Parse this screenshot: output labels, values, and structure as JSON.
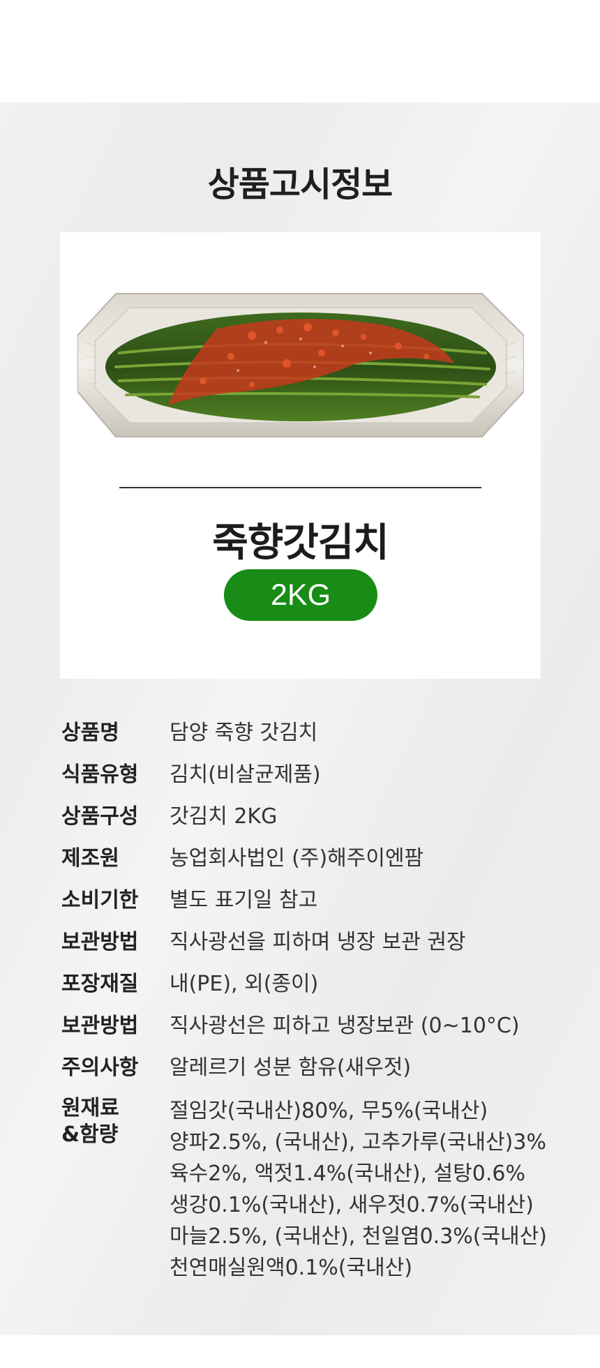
{
  "section_title": "상품고시정보",
  "product": {
    "name": "죽향갓김치",
    "weight": "2KG",
    "badge_color": "#188c16"
  },
  "info_rows": [
    {
      "label": "상품명",
      "value": "담양 죽향 갓김치"
    },
    {
      "label": "식품유형",
      "value": "김치(비살균제품)"
    },
    {
      "label": "상품구성",
      "value": "갓김치 2KG"
    },
    {
      "label": "제조원",
      "value": "농업회사법인 (주)해주이엔팜"
    },
    {
      "label": "소비기한",
      "value": "별도 표기일 참고"
    },
    {
      "label": "보관방법",
      "value": "직사광선을 피하며 냉장 보관 권장"
    },
    {
      "label": "포장재질",
      "value": "내(PE), 외(종이)"
    },
    {
      "label": "보관방법",
      "value": "직사광선은 피하고 냉장보관 (0~10°C)"
    },
    {
      "label": "주의사항",
      "value": "알레르기 성분 함유(새우젓)"
    }
  ],
  "ingredients": {
    "label_line1": "원재료",
    "label_line2": "&함량",
    "lines": [
      "절임갓(국내산)80%, 무5%(국내산)",
      "양파2.5%, (국내산), 고추가루(국내산)3%",
      "육수2%, 액젓1.4%(국내산), 설탕0.6%",
      "생강0.1%(국내산), 새우젓0.7%(국내산)",
      "마늘2.5%, (국내산), 천일염0.3%(국내산)",
      "천연매실원액0.1%(국내산)"
    ]
  }
}
